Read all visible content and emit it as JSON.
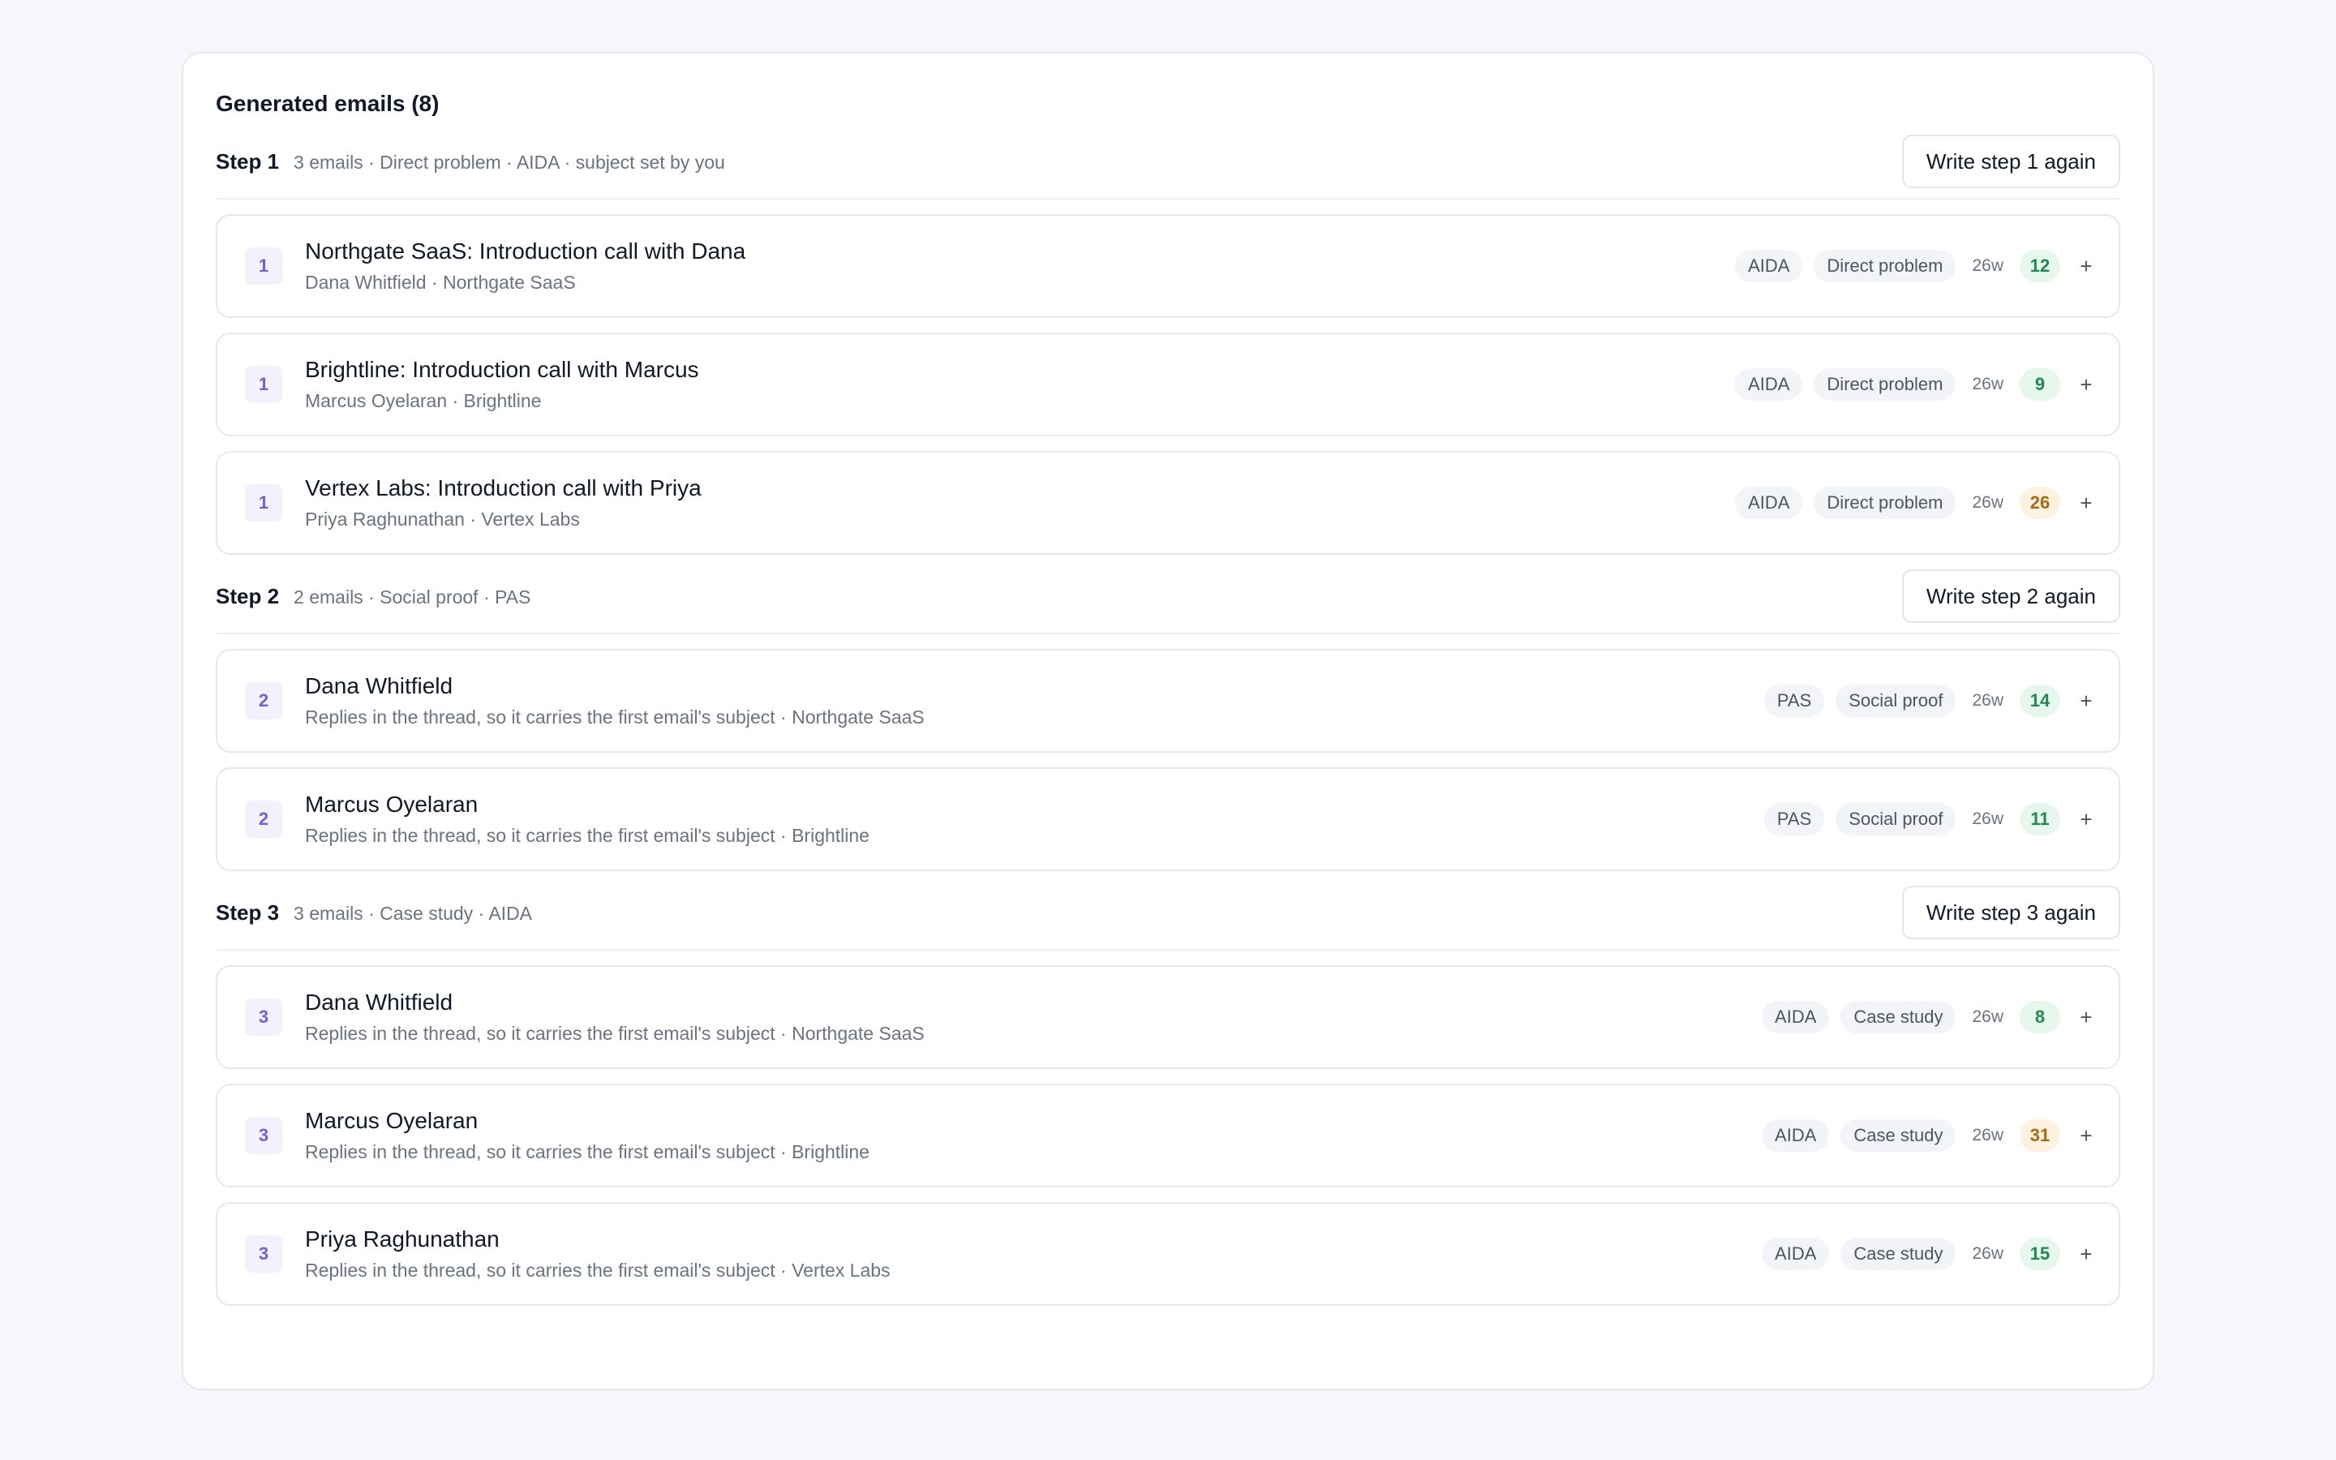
{
  "panel": {
    "title": "Generated emails (8)"
  },
  "steps": [
    {
      "name": "Step 1",
      "meta": "3 emails · Direct problem · AIDA · subject set by you",
      "again_label": "Write step 1 again",
      "emails": [
        {
          "num": "1",
          "title": "Northgate SaaS: Introduction call with Dana",
          "sub": "Dana Whitfield · Northgate SaaS",
          "framework": "AIDA",
          "angle": "Direct problem",
          "words": "26w",
          "score": "12",
          "score_tone": "green"
        },
        {
          "num": "1",
          "title": "Brightline: Introduction call with Marcus",
          "sub": "Marcus Oyelaran · Brightline",
          "framework": "AIDA",
          "angle": "Direct problem",
          "words": "26w",
          "score": "9",
          "score_tone": "green"
        },
        {
          "num": "1",
          "title": "Vertex Labs: Introduction call with Priya",
          "sub": "Priya Raghunathan · Vertex Labs",
          "framework": "AIDA",
          "angle": "Direct problem",
          "words": "26w",
          "score": "26",
          "score_tone": "amber"
        }
      ]
    },
    {
      "name": "Step 2",
      "meta": "2 emails · Social proof · PAS",
      "again_label": "Write step 2 again",
      "emails": [
        {
          "num": "2",
          "title": "Dana Whitfield",
          "sub": "Replies in the thread, so it carries the first email's subject · Northgate SaaS",
          "framework": "PAS",
          "angle": "Social proof",
          "words": "26w",
          "score": "14",
          "score_tone": "green"
        },
        {
          "num": "2",
          "title": "Marcus Oyelaran",
          "sub": "Replies in the thread, so it carries the first email's subject · Brightline",
          "framework": "PAS",
          "angle": "Social proof",
          "words": "26w",
          "score": "11",
          "score_tone": "green"
        }
      ]
    },
    {
      "name": "Step 3",
      "meta": "3 emails · Case study · AIDA",
      "again_label": "Write step 3 again",
      "emails": [
        {
          "num": "3",
          "title": "Dana Whitfield",
          "sub": "Replies in the thread, so it carries the first email's subject · Northgate SaaS",
          "framework": "AIDA",
          "angle": "Case study",
          "words": "26w",
          "score": "8",
          "score_tone": "green"
        },
        {
          "num": "3",
          "title": "Marcus Oyelaran",
          "sub": "Replies in the thread, so it carries the first email's subject · Brightline",
          "framework": "AIDA",
          "angle": "Case study",
          "words": "26w",
          "score": "31",
          "score_tone": "amber"
        },
        {
          "num": "3",
          "title": "Priya Raghunathan",
          "sub": "Replies in the thread, so it carries the first email's subject · Vertex Labs",
          "framework": "AIDA",
          "angle": "Case study",
          "words": "26w",
          "score": "15",
          "score_tone": "green"
        }
      ]
    }
  ],
  "row_action_icon": {
    "name": "plus-icon",
    "glyph": "+"
  },
  "colors": {
    "accent": "#6f62d4",
    "score_green": "#1f8a4c",
    "score_amber": "#a76a12"
  }
}
